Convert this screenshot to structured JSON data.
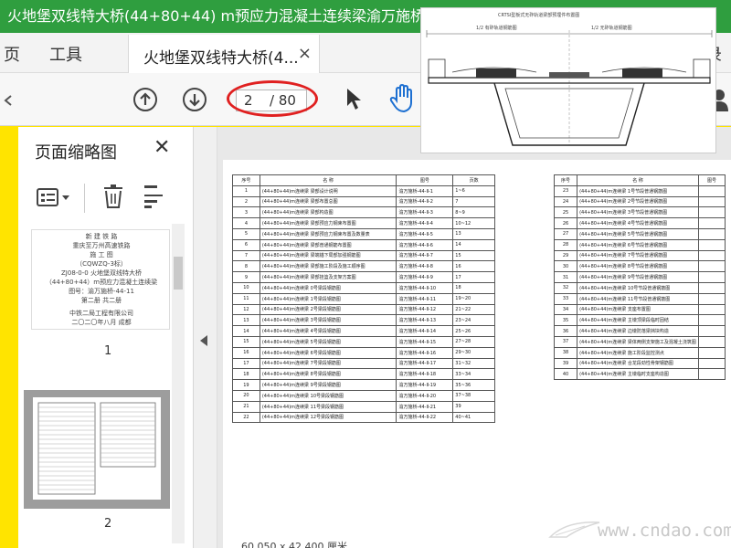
{
  "window": {
    "title": "火地堡双线特大桥(44+80+44) m预应力混凝土连续梁渝万施桥（第二"
  },
  "menu": {
    "page": "页",
    "tools": "工具",
    "login": "登录"
  },
  "tab": {
    "label": "火地堡双线特大桥(4...",
    "close": "×"
  },
  "toolbar": {
    "current_page": "2",
    "total_pages": "/ 80"
  },
  "panel": {
    "title": "页面缩略图",
    "close": "✕"
  },
  "thumbnail1": {
    "lines": [
      "新 建 铁 路",
      "重庆至万州高速铁路",
      "施 工 图",
      "（CQWZQ-3标）",
      "ZJ08-0-0 火地堡双线特大桥",
      "（44+80+44）m预应力混凝土连续梁",
      "图号：渝万施桥-44-11",
      "第二册 共二册",
      "中铁二局工程有限公司",
      "二〇二〇年八月 成都"
    ],
    "page_number": "1"
  },
  "thumbnail2": {
    "page_number": "2"
  },
  "toc": {
    "headers": [
      "序号",
      "名 称",
      "图号",
      "页数"
    ],
    "left_rows": [
      [
        "1",
        "(44+80+44)m连续梁 梁部设计说明",
        "渝万施桥-44-Ⅱ-1",
        "1~6"
      ],
      [
        "2",
        "(44+80+44)m连续梁 梁部布置总图",
        "渝万施桥-44-Ⅱ-2",
        "7"
      ],
      [
        "3",
        "(44+80+44)m连续梁 梁部构造图",
        "渝万施桥-44-Ⅱ-3",
        "8~9"
      ],
      [
        "4",
        "(44+80+44)m连续梁 梁部预应力钢束布置图",
        "渝万施桥-44-Ⅱ-4",
        "10~12"
      ],
      [
        "5",
        "(44+80+44)m连续梁 梁部预应力钢束布置及数量表",
        "渝万施桥-44-Ⅱ-5",
        "13"
      ],
      [
        "6",
        "(44+80+44)m连续梁 梁部普通钢筋布置图",
        "渝万施桥-44-Ⅱ-6",
        "14"
      ],
      [
        "7",
        "(44+80+44)m连续梁 梁端锚下局部加强钢筋图",
        "渝万施桥-44-Ⅱ-7",
        "15"
      ],
      [
        "8",
        "(44+80+44)m连续梁 梁部施工阶段及施工顺序图",
        "渝万施桥-44-Ⅱ-8",
        "16"
      ],
      [
        "9",
        "(44+80+44)m连续梁 梁部挂篮及支架方案图",
        "渝万施桥-44-Ⅱ-9",
        "17"
      ],
      [
        "10",
        "(44+80+44)m连续梁 0号梁段钢筋图",
        "渝万施桥-44-Ⅱ-10",
        "18"
      ],
      [
        "11",
        "(44+80+44)m连续梁 1号梁段钢筋图",
        "渝万施桥-44-Ⅱ-11",
        "19~20"
      ],
      [
        "12",
        "(44+80+44)m连续梁 2号梁段钢筋图",
        "渝万施桥-44-Ⅱ-12",
        "21~22"
      ],
      [
        "13",
        "(44+80+44)m连续梁 3号梁段钢筋图",
        "渝万施桥-44-Ⅱ-13",
        "23~24"
      ],
      [
        "14",
        "(44+80+44)m连续梁 4号梁段钢筋图",
        "渝万施桥-44-Ⅱ-14",
        "25~26"
      ],
      [
        "15",
        "(44+80+44)m连续梁 5号梁段钢筋图",
        "渝万施桥-44-Ⅱ-15",
        "27~28"
      ],
      [
        "16",
        "(44+80+44)m连续梁 6号梁段钢筋图",
        "渝万施桥-44-Ⅱ-16",
        "29~30"
      ],
      [
        "17",
        "(44+80+44)m连续梁 7号梁段钢筋图",
        "渝万施桥-44-Ⅱ-17",
        "31~32"
      ],
      [
        "18",
        "(44+80+44)m连续梁 8号梁段钢筋图",
        "渝万施桥-44-Ⅱ-18",
        "33~34"
      ],
      [
        "19",
        "(44+80+44)m连续梁 9号梁段钢筋图",
        "渝万施桥-44-Ⅱ-19",
        "35~36"
      ],
      [
        "20",
        "(44+80+44)m连续梁 10号梁段钢筋图",
        "渝万施桥-44-Ⅱ-20",
        "37~38"
      ],
      [
        "21",
        "(44+80+44)m连续梁 11号梁段钢筋图",
        "渝万施桥-44-Ⅱ-21",
        "39"
      ],
      [
        "22",
        "(44+80+44)m连续梁 12号梁段钢筋图",
        "渝万施桥-44-Ⅱ-22",
        "40~41"
      ]
    ],
    "right_rows": [
      [
        "23",
        "(44+80+44)m连续梁 1号节段普通钢筋图"
      ],
      [
        "24",
        "(44+80+44)m连续梁 2号节段普通钢筋图"
      ],
      [
        "25",
        "(44+80+44)m连续梁 3号节段普通钢筋图"
      ],
      [
        "26",
        "(44+80+44)m连续梁 4号节段普通钢筋图"
      ],
      [
        "27",
        "(44+80+44)m连续梁 5号节段普通钢筋图"
      ],
      [
        "28",
        "(44+80+44)m连续梁 6号节段普通钢筋图"
      ],
      [
        "29",
        "(44+80+44)m连续梁 7号节段普通钢筋图"
      ],
      [
        "30",
        "(44+80+44)m连续梁 8号节段普通钢筋图"
      ],
      [
        "31",
        "(44+80+44)m连续梁 9号节段普通钢筋图"
      ],
      [
        "32",
        "(44+80+44)m连续梁 10号节段普通钢筋图"
      ],
      [
        "33",
        "(44+80+44)m连续梁 11号节段普通钢筋图"
      ],
      [
        "34",
        "(44+80+44)m连续梁 支座布置图"
      ],
      [
        "35",
        "(44+80+44)m连续梁 主墩顶梁段临时固结"
      ],
      [
        "36",
        "(44+80+44)m连续梁 边墩防落梁挡块构造"
      ],
      [
        "37",
        "(44+80+44)m连续梁 梁体两侧支架施工及混凝土浇筑图"
      ],
      [
        "38",
        "(44+80+44)m连续梁 施工阶段监控测点"
      ],
      [
        "39",
        "(44+80+44)m连续梁 合龙段劲性骨架钢筋图"
      ],
      [
        "40",
        "(44+80+44)m连续梁 主墩临时支座构造图"
      ]
    ]
  },
  "overlay": {
    "title": "CRTSⅠ型板式无砟轨道梁部预埋件布置图",
    "left_label": "1/2 有砟轨道钢筋图",
    "right_label": "1/2 无砟轨道钢筋图"
  },
  "status": {
    "coords": "60.050 x 42.400 厘米"
  },
  "watermark": {
    "text": "www.cndao.com"
  }
}
